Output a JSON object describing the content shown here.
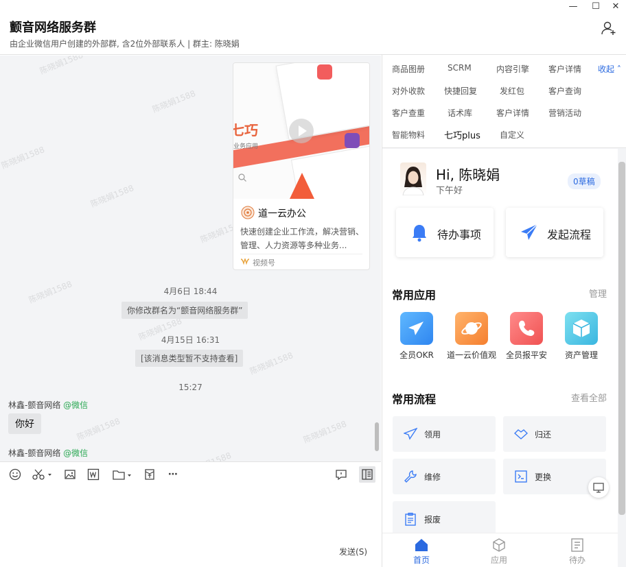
{
  "window": {
    "minimize": "—",
    "maximize": "☐",
    "close": "✕"
  },
  "header": {
    "title": "颤音网络服务群",
    "subtitle": "由企业微信用户创建的外部群, 含2位外部联系人 | 群主: 陈晓娟"
  },
  "watermark": "陈晓娟1588",
  "card": {
    "image_text": "七巧",
    "image_sub": "业务应用",
    "title": "道一云办公",
    "desc": "快速创建企业工作流，解决营销、管理、人力资源等多种业务...",
    "source": "视频号"
  },
  "messages": {
    "time1": "4月6日 18:44",
    "sys1": "你修改群名为“颤音网络服务群”",
    "time2": "4月15日 16:31",
    "sys2": "[该消息类型暂不支持查看]",
    "time3": "15:27",
    "sender1": "林鑫-颤音网络",
    "sender1_tag": "@微信",
    "bubble1": "你好",
    "sender2": "林鑫-颤音网络",
    "sender2_tag": "@微信"
  },
  "input": {
    "send": "发送(S)"
  },
  "tabs": {
    "row1": [
      "商品图册",
      "SCRM",
      "内容引擎",
      "客户详情"
    ],
    "collapse": "收起 ˄",
    "row2": [
      "对外收款",
      "快捷回复",
      "发红包",
      "客户查询"
    ],
    "row3": [
      "客户查重",
      "话术库",
      "客户详情",
      "营销活动"
    ],
    "row4": [
      "智能物料",
      "七巧plus",
      "自定义"
    ]
  },
  "panel": {
    "greeting": "Hi, 陈晓娟",
    "greeting_sub": "下午好",
    "draft": "0草稿",
    "todo": "待办事项",
    "start_flow": "发起流程",
    "apps_title": "常用应用",
    "apps_manage": "管理",
    "apps": [
      "全员OKR",
      "道一云价值观",
      "全员报平安",
      "资产管理"
    ],
    "flows_title": "常用流程",
    "flows_all": "查看全部",
    "flows": [
      "领用",
      "归还",
      "维修",
      "更换",
      "报废"
    ]
  },
  "nav": {
    "home": "首页",
    "apps": "应用",
    "todo": "待办"
  },
  "colors": {
    "accent": "#2b6ae0",
    "wechat_green": "#2aa752"
  }
}
